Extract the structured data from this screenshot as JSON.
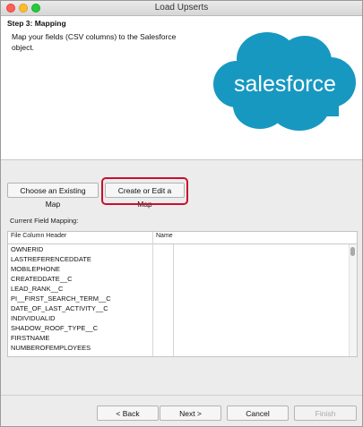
{
  "window": {
    "title": "Load Upserts"
  },
  "step": {
    "title": "Step 3: Mapping",
    "description": "Map your fields (CSV columns) to the Salesforce object."
  },
  "logo": {
    "text": "salesforce",
    "color": "#1798c1"
  },
  "buttons": {
    "choose_existing": "Choose an Existing Map",
    "create_edit": "Create or Edit a Map",
    "back": "< Back",
    "next": "Next >",
    "cancel": "Cancel",
    "finish": "Finish"
  },
  "mapping": {
    "label": "Current Field Mapping:",
    "columns": [
      "File Column Header",
      "Name"
    ],
    "rows": [
      "OWNERID",
      "LASTREFERENCEDDATE",
      "MOBILEPHONE",
      "CREATEDDATE__C",
      "LEAD_RANK__C",
      "PI__FIRST_SEARCH_TERM__C",
      "DATE_OF_LAST_ACTIVITY__C",
      "INDIVIDUALID",
      "SHADOW_ROOF_TYPE__C",
      "FIRSTNAME",
      "NUMBEROFEMPLOYEES"
    ]
  },
  "colors": {
    "highlight": "#c8102e"
  }
}
